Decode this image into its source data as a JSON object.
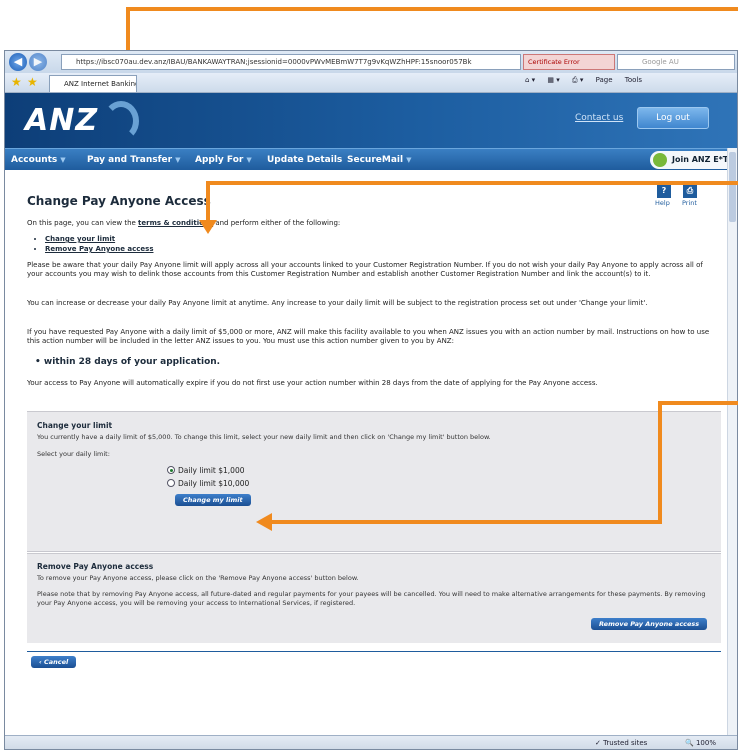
{
  "browser": {
    "url": "https://ibsc070au.dev.anz/IBAU/BANKAWAYTRAN;jsessionid=0000vPWvMEBmW7T7g9vKqWZhHPF:15snoor057Bk",
    "cert_error": "Certificate Error",
    "search_placeholder": "Google AU",
    "tab_title": "ANZ Internet Banking",
    "tools": [
      "Page",
      "Tools"
    ],
    "status_trusted": "Trusted sites",
    "status_zoom": "100%"
  },
  "header": {
    "logo": "ANZ",
    "contact_link": "Contact us",
    "logout_label": "Log out",
    "menu": [
      "Accounts",
      "Pay and Transfer",
      "Apply For",
      "Update Details",
      "SecureMail"
    ],
    "etrade_join": "Join",
    "etrade_label": "ANZ E*TRADE"
  },
  "page": {
    "title": "Change Pay Anyone Access",
    "help_label": "Help",
    "print_label": "Print",
    "intro_before": "On this page, you can view the ",
    "terms_link": "terms & conditions",
    "intro_after": " and perform either of the following:",
    "options": [
      "Change your limit",
      "Remove Pay Anyone access"
    ],
    "para1": "Please be aware that your daily Pay Anyone limit will apply across all your accounts linked to your Customer Registration Number. If you do not wish your daily Pay Anyone to apply across all of your accounts you may wish to delink those accounts from this Customer Registration Number and establish another Customer Registration Number and link the account(s) to it.",
    "para2": "You can increase or decrease your daily Pay Anyone limit at anytime. Any increase to your daily limit will be subject to the registration process set out under 'Change your limit'.",
    "para3": "If you have requested Pay Anyone with a daily limit of $5,000 or more, ANZ will make this facility available to you when ANZ issues you with an action number by mail. Instructions on how to use this action number will be included in the letter ANZ issues to you. You must use this action number given to you by ANZ:",
    "deadline": "within 28 days of your application.",
    "para4": "Your access to Pay Anyone will automatically expire if you do not first use your action number within 28 days from the date of applying for the Pay Anyone access."
  },
  "change_limit": {
    "title": "Change your limit",
    "desc": "You currently have a daily limit of $5,000. To change this limit, select your new daily limit and then click on 'Change my limit' button below.",
    "select_label": "Select your daily limit:",
    "options": [
      "Daily limit $1,000",
      "Daily limit $10,000"
    ],
    "selected": 0,
    "button": "Change my limit"
  },
  "remove_access": {
    "title": "Remove Pay Anyone access",
    "desc": "To remove your Pay Anyone access, please click on the 'Remove Pay Anyone access' button below.",
    "note": "Please note that by removing Pay Anyone access, all future-dated and regular payments for your payees will be cancelled. You will need to make alternative arrangements for these payments. By removing your Pay Anyone access, you will be removing your access to International Services, if registered.",
    "button": "Remove Pay Anyone access"
  },
  "footer": {
    "cancel_label": "Cancel"
  },
  "colors": {
    "annotation_arrow": "#f08a1e",
    "anz_blue": "#1c5da0"
  }
}
